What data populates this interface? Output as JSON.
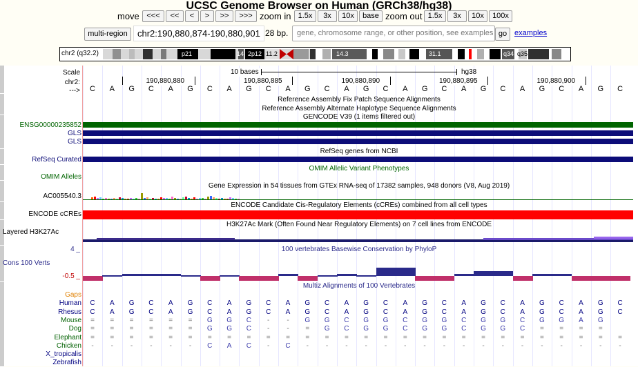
{
  "title": "UCSC Genome Browser on Human (GRCh38/hg38)",
  "nav": {
    "move_label": "move",
    "move_buttons": [
      "<<<",
      "<<",
      "<",
      ">",
      ">>",
      ">>>"
    ],
    "zoom_in_label": "zoom in",
    "zoom_in_buttons": [
      "1.5x",
      "3x",
      "10x",
      "base"
    ],
    "zoom_out_label": "zoom out",
    "zoom_out_buttons": [
      "1.5x",
      "3x",
      "10x",
      "100x"
    ]
  },
  "position": {
    "multi_region_label": "multi-region",
    "value": "chr2:190,880,874-190,880,901",
    "size": "28 bp.",
    "search_placeholder": "gene, chromosome range, or other position, see examples",
    "go_label": "go",
    "examples_label": "examples"
  },
  "ideogram": {
    "chrom_label": "chr2 (q32.2)",
    "bands": [
      "p21",
      "14",
      "2p12",
      "11.2",
      "14.3",
      "31.1",
      "q34",
      "q35"
    ]
  },
  "ruler": {
    "scale_label": "Scale",
    "chrom_label": "chr2:",
    "arrow_label": "--->",
    "scale_text": "10 bases",
    "assembly": "hg38",
    "positions": [
      "190,880,880",
      "190,880,885",
      "190,880,890",
      "190,880,895",
      "190,880,900"
    ]
  },
  "sequence": [
    "C",
    "A",
    "G",
    "C",
    "A",
    "G",
    "C",
    "A",
    "G",
    "C",
    "A",
    "G",
    "C",
    "A",
    "G",
    "C",
    "A",
    "G",
    "C",
    "A",
    "G",
    "C",
    "A",
    "G",
    "C",
    "A",
    "G",
    "C"
  ],
  "tracks": {
    "fix_patch": "Reference Assembly Fix Patch Sequence Alignments",
    "alt_haplotype": "Reference Assembly Alternate Haplotype Sequence Alignments",
    "gencode": "GENCODE V39 (1 items filtered out)",
    "gencode_labels": [
      "ENSG00000235852",
      "GLS",
      "GLS"
    ],
    "refseq_title": "RefSeq genes from NCBI",
    "refseq_label": "RefSeq Curated",
    "omim_title": "OMIM Allelic Variant Phenotypes",
    "omim_label": "OMIM Alleles",
    "gtex_title": "Gene Expression in 54 tissues from GTEx RNA-seq of 17382 samples, 948 donors (V8, Aug 2019)",
    "gtex_label": "AC005540.3",
    "encode_title": "ENCODE Candidate Cis-Regulatory Elements (cCREs) combined from all cell types",
    "encode_label": "ENCODE cCREs",
    "h3k27_title": "H3K27Ac Mark (Often Found Near Regulatory Elements) on 7 cell lines from ENCODE",
    "h3k27_label": "Layered H3K27Ac",
    "cons_title": "100 vertebrates Basewise Conservation by PhyloP",
    "cons_label": "Cons 100 Verts",
    "cons_max": "4 _",
    "cons_min": "-0.5 _",
    "multiz_title": "Multiz Alignments of 100 Vertebrates"
  },
  "species": [
    {
      "name": "Gaps",
      "color": "#e08000",
      "row": ""
    },
    {
      "name": "Human",
      "color": "#000080",
      "row": "CAGCAGCAGCAGCAGCAGCAGCAGCAGC"
    },
    {
      "name": "Rhesus",
      "color": "#000080",
      "row": "CAGCAGCAGCAGCAGCAGCAGCAGCAGC"
    },
    {
      "name": "Mouse",
      "color": "#006000",
      "row": "======GGC--GGCGGCGGCGGCGGAG"
    },
    {
      "name": "Dog",
      "color": "#006000",
      "row": "======GGC--=GCGGCGGCGGC===="
    },
    {
      "name": "Elephant",
      "color": "#006000",
      "row": "============================"
    },
    {
      "name": "Chicken",
      "color": "#006000",
      "row": "------CAC-C-----------------"
    },
    {
      "name": "X_tropicalis",
      "color": "#000080",
      "row": ""
    },
    {
      "name": "Zebrafish",
      "color": "#000080",
      "row": ""
    }
  ],
  "colors": {
    "gencode": "#006400",
    "gls": "#0c0c78",
    "encode": "#ff0000",
    "cons_pos": "#2a2a8a",
    "cons_neg": "#c0306a",
    "fix_patch": "#b8860b",
    "alt_haplotype": "#1f1f9a",
    "link": "#0000cc"
  }
}
